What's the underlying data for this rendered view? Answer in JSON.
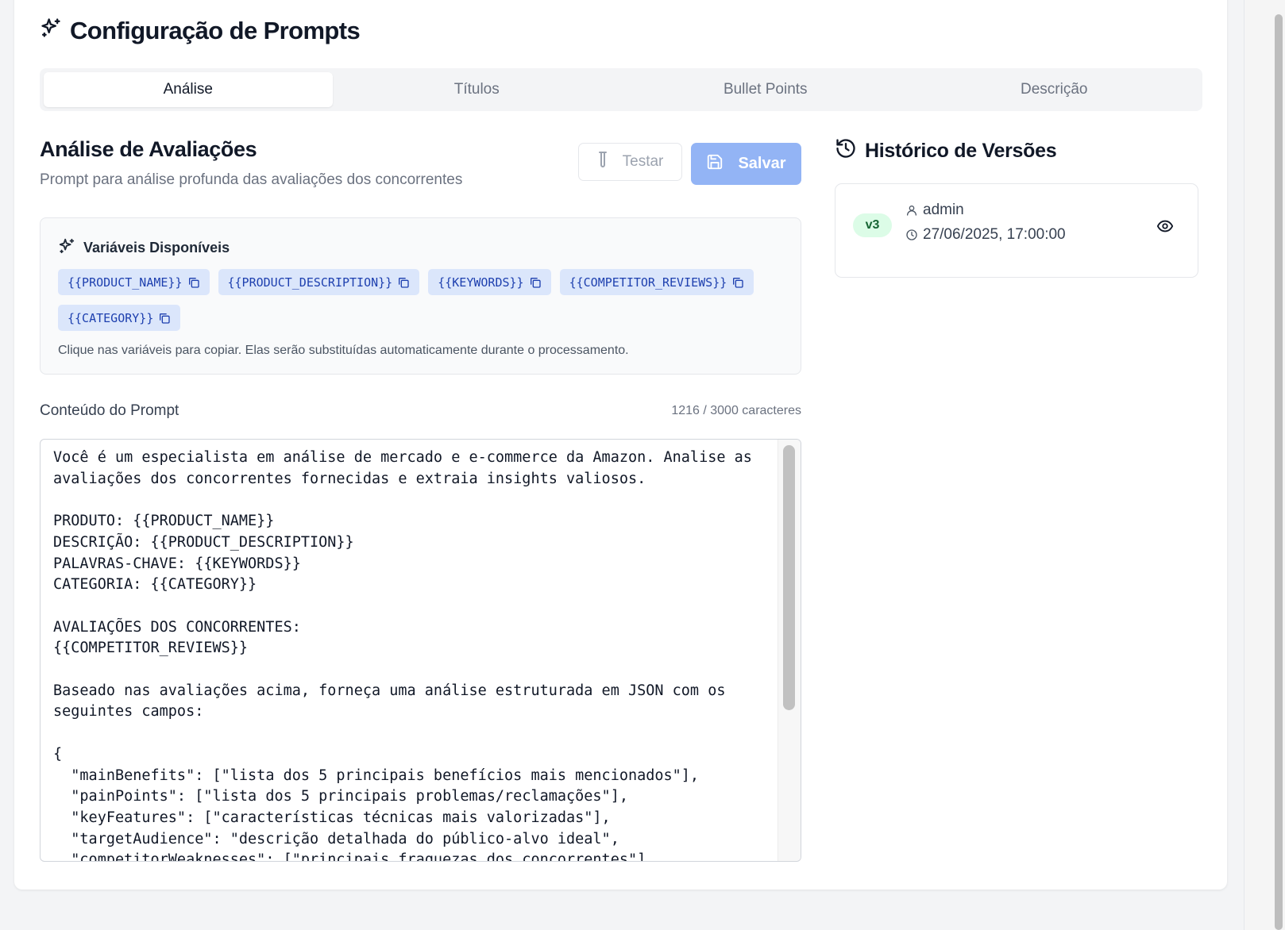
{
  "page": {
    "title": "Configuração de Prompts",
    "title_icon": "sparkles-icon"
  },
  "tabs": [
    {
      "label": "Análise",
      "active": true
    },
    {
      "label": "Títulos",
      "active": false
    },
    {
      "label": "Bullet Points",
      "active": false
    },
    {
      "label": "Descrição",
      "active": false
    }
  ],
  "section": {
    "title": "Análise de Avaliações",
    "subtitle": "Prompt para análise profunda das avaliações dos concorrentes",
    "test_label": "Testar",
    "save_label": "Salvar"
  },
  "variables": {
    "title": "Variáveis Disponíveis",
    "chips": [
      "{{PRODUCT_NAME}}",
      "{{PRODUCT_DESCRIPTION}}",
      "{{KEYWORDS}}",
      "{{COMPETITOR_REVIEWS}}",
      "{{CATEGORY}}"
    ],
    "help": "Clique nas variáveis para copiar. Elas serão substituídas automaticamente durante o processamento."
  },
  "prompt": {
    "label": "Conteúdo do Prompt",
    "char_count": "1216 / 3000 caracteres",
    "content": "Você é um especialista em análise de mercado e e-commerce da Amazon. Analise as avaliações dos concorrentes fornecidas e extraia insights valiosos.\n\nPRODUTO: {{PRODUCT_NAME}}\nDESCRIÇÃO: {{PRODUCT_DESCRIPTION}}\nPALAVRAS-CHAVE: {{KEYWORDS}}\nCATEGORIA: {{CATEGORY}}\n\nAVALIAÇÕES DOS CONCORRENTES:\n{{COMPETITOR_REVIEWS}}\n\nBaseado nas avaliações acima, forneça uma análise estruturada em JSON com os seguintes campos:\n\n{\n  \"mainBenefits\": [\"lista dos 5 principais benefícios mais mencionados\"],\n  \"painPoints\": [\"lista dos 5 principais problemas/reclamações\"],\n  \"keyFeatures\": [\"características técnicas mais valorizadas\"],\n  \"targetAudience\": \"descrição detalhada do público-alvo ideal\",\n  \"competitorWeaknesses\": [\"principais fraquezas dos concorrentes\"],"
  },
  "history": {
    "title": "Histórico de Versões",
    "versions": [
      {
        "version": "v3",
        "user": "admin",
        "date": "27/06/2025, 17:00:00"
      }
    ]
  }
}
